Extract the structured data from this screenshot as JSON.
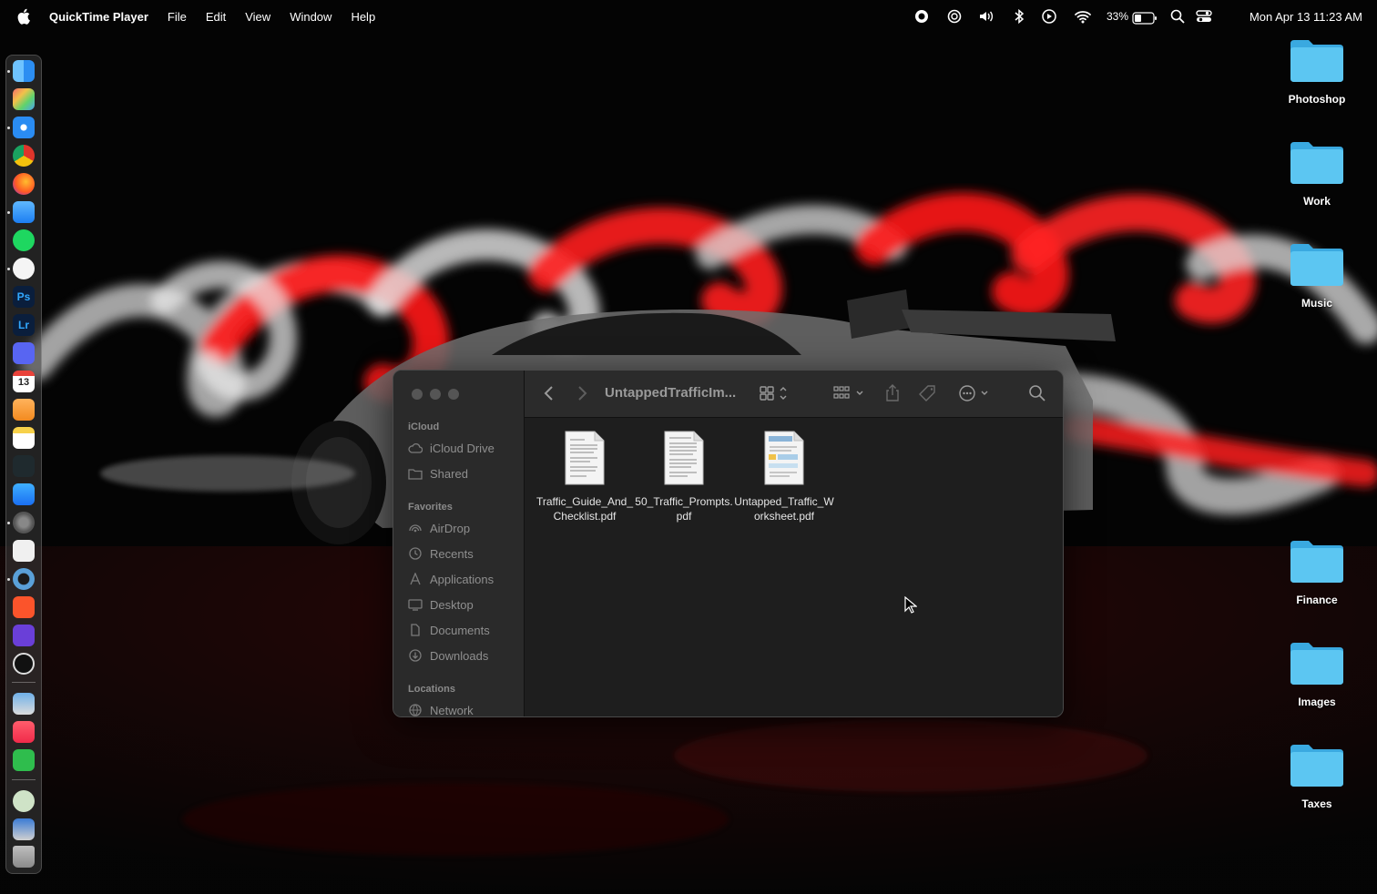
{
  "menubar": {
    "app_name": "QuickTime Player",
    "menus": [
      "File",
      "Edit",
      "View",
      "Window",
      "Help"
    ],
    "status_icons": [
      "screen-record-icon",
      "openai-icon",
      "volume-icon",
      "bluetooth-icon",
      "play-circle-icon",
      "wifi-icon",
      "battery-icon",
      "spotlight-search-icon",
      "control-center-icon"
    ],
    "battery_percent": "33%",
    "clock": "Mon Apr 13  11:23 AM"
  },
  "dock": {
    "apps": [
      {
        "name": "finder",
        "label": ""
      },
      {
        "name": "launchpad",
        "label": ""
      },
      {
        "name": "safari",
        "label": ""
      },
      {
        "name": "chrome",
        "label": ""
      },
      {
        "name": "firefox",
        "label": ""
      },
      {
        "name": "mail",
        "label": ""
      },
      {
        "name": "spotify",
        "label": ""
      },
      {
        "name": "chatgpt",
        "label": ""
      },
      {
        "name": "photoshop",
        "label": "Ps"
      },
      {
        "name": "lightroom",
        "label": "Lr"
      },
      {
        "name": "discord",
        "label": ""
      },
      {
        "name": "calendar",
        "label": "13"
      },
      {
        "name": "pages",
        "label": ""
      },
      {
        "name": "notes",
        "label": ""
      },
      {
        "name": "perplexity",
        "label": ""
      },
      {
        "name": "app-store",
        "label": ""
      },
      {
        "name": "system-settings",
        "label": ""
      },
      {
        "name": "textedit",
        "label": ""
      },
      {
        "name": "quicktime",
        "label": ""
      },
      {
        "name": "brave",
        "label": ""
      },
      {
        "name": "imovie",
        "label": ""
      },
      {
        "name": "clock",
        "label": ""
      },
      {
        "name": "preview",
        "label": ""
      },
      {
        "name": "music",
        "label": ""
      },
      {
        "name": "numbers",
        "label": ""
      },
      {
        "name": "downloads-stack",
        "label": ""
      },
      {
        "name": "screenshots-stack",
        "label": ""
      },
      {
        "name": "trash",
        "label": ""
      }
    ]
  },
  "desktop": {
    "folders": [
      "Photoshop",
      "Work",
      "Music",
      "Finance",
      "Images",
      "Taxes"
    ]
  },
  "finder": {
    "title": "UntappedTrafficIm...",
    "sidebar": {
      "icloud_header": "iCloud",
      "icloud_items": [
        "iCloud Drive",
        "Shared"
      ],
      "favorites_header": "Favorites",
      "favorites_items": [
        "AirDrop",
        "Recents",
        "Applications",
        "Desktop",
        "Documents",
        "Downloads"
      ],
      "locations_header": "Locations",
      "locations_items": [
        "Network"
      ]
    },
    "files": [
      {
        "name": "Traffic_Guide_And_Checklist.pdf"
      },
      {
        "name": "50_Traffic_Prompts.pdf"
      },
      {
        "name": "Untapped_Traffic_Worksheet.pdf"
      }
    ]
  },
  "colors": {
    "folder_blue": "#56c1ef",
    "window_bg": "#1e1e1e",
    "sidebar_bg": "#2a2a2a",
    "accent_red": "#e0141a"
  }
}
